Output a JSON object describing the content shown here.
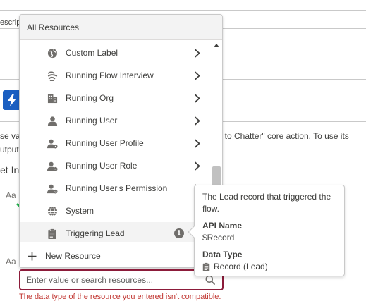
{
  "background": {
    "field_label_fragment": "escript",
    "description_left": "se val",
    "description_right": "t to Chatter\" core action. To use its",
    "outputs_fragment": "utputs",
    "section_fragment": "et Inp",
    "aa_icon_1": "Aa",
    "aa_icon_2": "Aa"
  },
  "dropdown": {
    "header": "All Resources",
    "items": [
      {
        "label": "Custom Label",
        "icon": "globe-icon",
        "has_chevron": true
      },
      {
        "label": "Running Flow Interview",
        "icon": "flow-interview-icon",
        "has_chevron": true
      },
      {
        "label": "Running Org",
        "icon": "building-icon",
        "has_chevron": true
      },
      {
        "label": "Running User",
        "icon": "user-icon",
        "has_chevron": true
      },
      {
        "label": "Running User Profile",
        "icon": "user-profile-icon",
        "has_chevron": true
      },
      {
        "label": "Running User Role",
        "icon": "user-role-icon",
        "has_chevron": true
      },
      {
        "label": "Running User's Permission",
        "icon": "user-permission-icon",
        "has_chevron": true
      },
      {
        "label": "System",
        "icon": "system-globe-icon",
        "has_chevron": true
      },
      {
        "label": "Triggering Lead",
        "icon": "clipboard-icon",
        "has_info": true
      }
    ],
    "footer_label": "New Resource"
  },
  "search": {
    "placeholder": "Enter value or search resources...",
    "value": ""
  },
  "error_text": "The data type of the resource you entered isn't compatible.",
  "popover": {
    "description": "The Lead record that triggered the flow.",
    "api_name_label": "API Name",
    "api_name_value": "$Record",
    "data_type_label": "Data Type",
    "data_type_value": "Record (Lead)"
  },
  "colors": {
    "accent_blue": "#1b5fc1",
    "error_red": "#c23934",
    "annotation_green": "#22b24c"
  }
}
